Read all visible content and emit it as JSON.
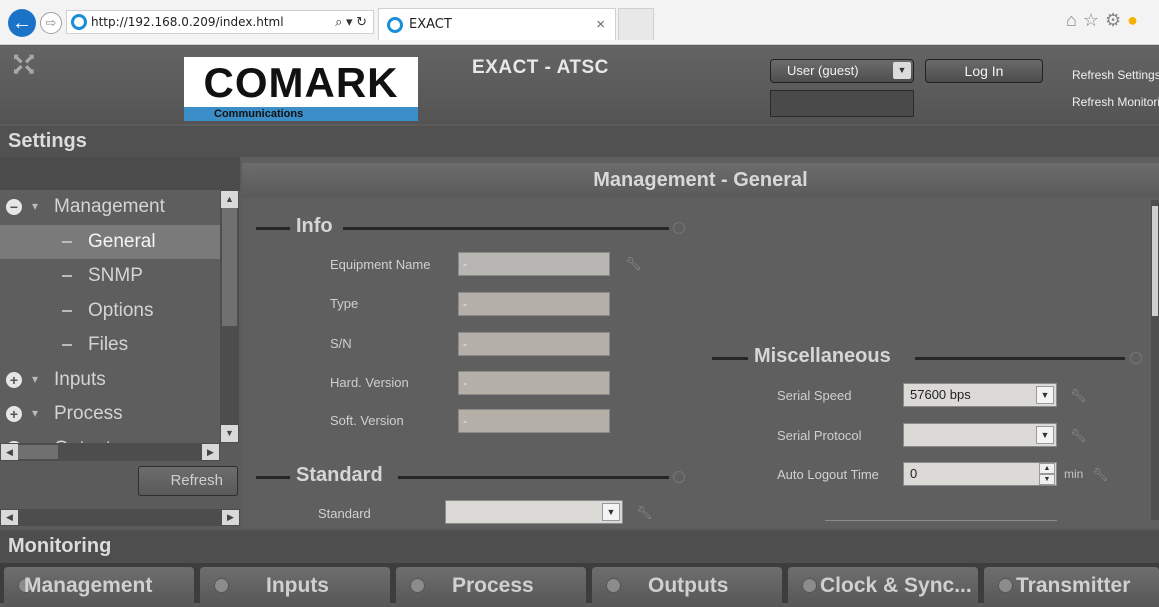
{
  "browser": {
    "url": "http://192.168.0.209/index.html",
    "address_controls": "⌕ ▾ ↻",
    "tab_title": "EXACT",
    "tab_close": "×"
  },
  "header": {
    "logo_text": "COMARK",
    "logo_subtext": "Communications",
    "app_title": "EXACT  - ATSC",
    "user_select_value": "User (guest)",
    "login_label": "Log In",
    "refresh_settings": "Refresh Settings",
    "refresh_monitoring": "Refresh Monitoring"
  },
  "settings": {
    "title": "Settings",
    "tree": [
      {
        "label": "Management",
        "type": "folder",
        "expanded": true
      },
      {
        "label": "General",
        "type": "leaf",
        "selected": true
      },
      {
        "label": "SNMP",
        "type": "leaf"
      },
      {
        "label": "Options",
        "type": "leaf"
      },
      {
        "label": "Files",
        "type": "leaf"
      },
      {
        "label": "Inputs",
        "type": "folder",
        "expanded": false
      },
      {
        "label": "Process",
        "type": "folder",
        "expanded": false
      },
      {
        "label": "Outputs",
        "type": "folder",
        "expanded": false
      }
    ],
    "refresh_label": "Refresh"
  },
  "panel": {
    "title": "Management - General",
    "info": {
      "heading": "Info",
      "fields": [
        {
          "label": "Equipment Name",
          "value": "-"
        },
        {
          "label": "Type",
          "value": "-"
        },
        {
          "label": "S/N",
          "value": "-"
        },
        {
          "label": "Hard. Version",
          "value": "-"
        },
        {
          "label": "Soft. Version",
          "value": "-"
        }
      ]
    },
    "standard": {
      "heading": "Standard",
      "field_label": "Standard",
      "field_value": ""
    },
    "misc": {
      "heading": "Miscellaneous",
      "serial_speed_label": "Serial Speed",
      "serial_speed_value": "57600 bps",
      "serial_protocol_label": "Serial Protocol",
      "serial_protocol_value": "",
      "auto_logout_label": "Auto Logout Time",
      "auto_logout_value": "0",
      "auto_logout_unit": "min"
    }
  },
  "monitoring": {
    "title": "Monitoring",
    "tabs": [
      "Management",
      "Inputs",
      "Process",
      "Outputs",
      "Clock & Sync...",
      "Transmitter"
    ]
  },
  "colors": {
    "accent_blue": "#3b8ec8",
    "panel_bg": "#5f5f5f",
    "selected_row": "#7a7a7a"
  }
}
